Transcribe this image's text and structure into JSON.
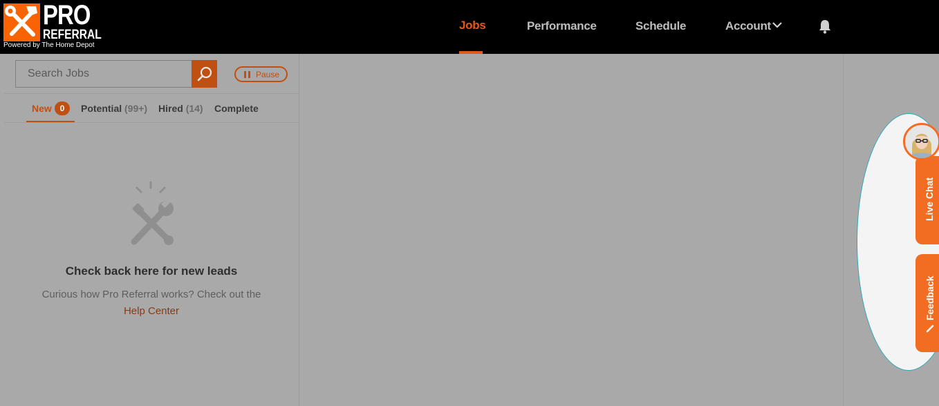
{
  "brand": {
    "name_line1": "PRO",
    "name_line2": "REFERRAL",
    "powered_by": "Powered by The Home Depot",
    "accent_color": "#f96302"
  },
  "nav": {
    "items": [
      {
        "label": "Jobs",
        "active": true
      },
      {
        "label": "Performance",
        "active": false
      },
      {
        "label": "Schedule",
        "active": false
      },
      {
        "label": "Account",
        "active": false,
        "dropdown": true
      }
    ],
    "notification_icon": "bell-icon"
  },
  "search": {
    "placeholder": "Search Jobs",
    "value": "",
    "button_icon": "search-icon"
  },
  "pause": {
    "label": "Pause",
    "icon": "pause-icon"
  },
  "tabs": [
    {
      "label": "New",
      "count": "0",
      "active": true
    },
    {
      "label": "Potential",
      "count": "(99+)",
      "active": false
    },
    {
      "label": "Hired",
      "count": "(14)",
      "active": false
    },
    {
      "label": "Complete",
      "count": "",
      "active": false
    }
  ],
  "empty_state": {
    "icon": "tools-icon",
    "title": "Check back here for new leads",
    "text": "Curious how Pro Referral works? Check out the",
    "link": "Help Center"
  },
  "side_widget": {
    "live_chat_label": "Live Chat",
    "feedback_label": "Feedback",
    "avatar": "agent-avatar",
    "accent_color": "#f26d21"
  }
}
